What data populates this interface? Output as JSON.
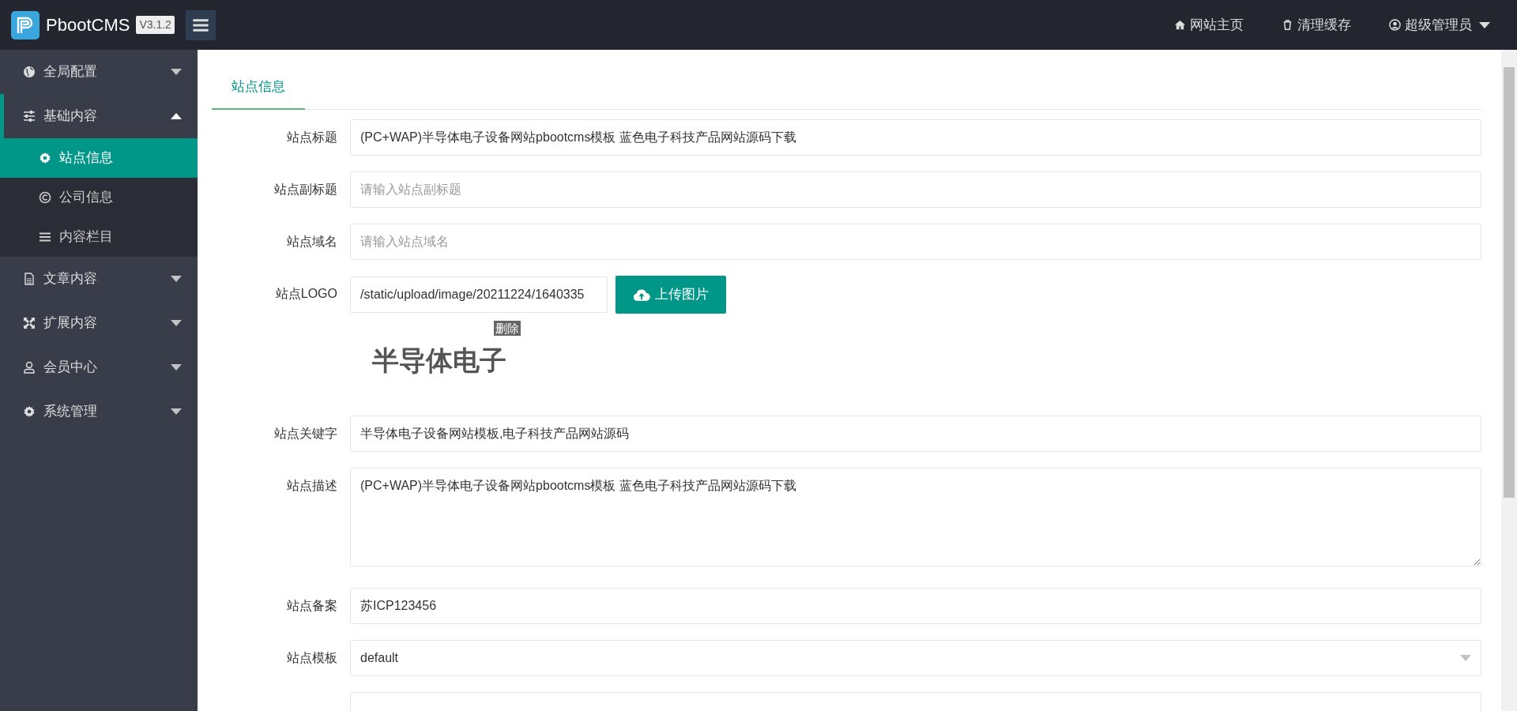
{
  "brand": {
    "name": "PbootCMS",
    "version": "V3.1.2"
  },
  "top_links": [
    {
      "label": "网站主页",
      "dropdown": false
    },
    {
      "label": "清理缓存",
      "dropdown": false
    },
    {
      "label": "超级管理员",
      "dropdown": true
    }
  ],
  "sidebar": {
    "items": [
      {
        "label": "全局配置",
        "expanded": false
      },
      {
        "label": "基础内容",
        "expanded": true,
        "children": [
          {
            "label": "站点信息",
            "selected": true
          },
          {
            "label": "公司信息",
            "selected": false
          },
          {
            "label": "内容栏目",
            "selected": false
          }
        ]
      },
      {
        "label": "文章内容",
        "expanded": false
      },
      {
        "label": "扩展内容",
        "expanded": false
      },
      {
        "label": "会员中心",
        "expanded": false
      },
      {
        "label": "系统管理",
        "expanded": false
      }
    ]
  },
  "tabs": [
    {
      "label": "站点信息",
      "selected": true
    }
  ],
  "form": {
    "fields": [
      {
        "kind": "text",
        "label": "站点标题",
        "value": "(PC+WAP)半导体电子设备网站pbootcms模板 蓝色电子科技产品网站源码下载"
      },
      {
        "kind": "text",
        "label": "站点副标题",
        "placeholder": "请输入站点副标题"
      },
      {
        "kind": "text",
        "label": "站点域名",
        "placeholder": "请输入站点域名"
      },
      {
        "kind": "upload",
        "label": "站点LOGO",
        "value": "/static/upload/image/20211224/1640335",
        "button": "上传图片",
        "delete_label": "删除",
        "preview": "半导体电子"
      },
      {
        "kind": "text",
        "label": "站点关键字",
        "value": "半导体电子设备网站模板,电子科技产品网站源码"
      },
      {
        "kind": "textarea",
        "label": "站点描述",
        "value": "(PC+WAP)半导体电子设备网站pbootcms模板 蓝色电子科技产品网站源码下载"
      },
      {
        "kind": "text",
        "label": "站点备案",
        "value": "苏ICP123456"
      },
      {
        "kind": "select",
        "label": "站点模板",
        "value": "default"
      },
      {
        "kind": "text"
      }
    ]
  }
}
